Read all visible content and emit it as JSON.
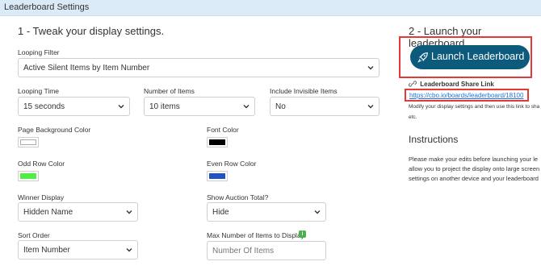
{
  "header": {
    "title": "Leaderboard Settings"
  },
  "section1": {
    "title": "1 - Tweak your display settings."
  },
  "section2": {
    "title": "2 - Launch your leaderboard."
  },
  "fields": {
    "looping_filter": {
      "label": "Looping Filter",
      "value": "Active Silent Items by Item Number"
    },
    "looping_time": {
      "label": "Looping Time",
      "value": "15 seconds"
    },
    "number_of_items": {
      "label": "Number of Items",
      "value": "10 items"
    },
    "include_invisible": {
      "label": "Include Invisible Items",
      "value": "No"
    },
    "page_bg_color": {
      "label": "Page Background Color",
      "color": "#ffffff"
    },
    "font_color": {
      "label": "Font Color",
      "color": "#000000"
    },
    "odd_row_color": {
      "label": "Odd Row Color",
      "color": "#4cf045"
    },
    "even_row_color": {
      "label": "Even Row Color",
      "color": "#2055c0"
    },
    "winner_display": {
      "label": "Winner Display",
      "value": "Hidden Name"
    },
    "show_auction_total": {
      "label": "Show Auction Total?",
      "value": "Hide"
    },
    "sort_order": {
      "label": "Sort Order",
      "value": "Item Number"
    },
    "max_items": {
      "label": "Max Number of Items to Display",
      "placeholder": "Number Of Items",
      "info_icon": "info-icon"
    }
  },
  "launch": {
    "button_label": "Launch Leaderboard",
    "icon": "rocket-icon",
    "button_color": "#0c5b7c",
    "highlight_color": "#e53935"
  },
  "share": {
    "heading": "Leaderboard Share Link",
    "icon": "link-icon",
    "url": "https://cbo.io/boards/leaderboard/18100",
    "note_line1": "Modify your display settings and then use this link to sha",
    "note_line2": "etc."
  },
  "instructions": {
    "title": "Instructions",
    "line1": "Please make your edits before launching your le",
    "line2": "allow you to project the display onto large screen",
    "line3": "settings on another device and your leaderboard"
  },
  "colors": {
    "header_bg": "#dbeaf7",
    "border": "#cfcfcf",
    "link": "#1a73e8"
  }
}
